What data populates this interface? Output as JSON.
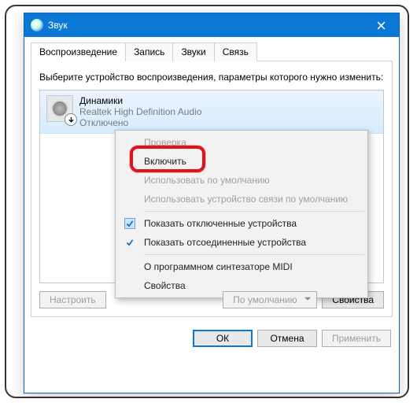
{
  "window": {
    "title": "Звук",
    "close_icon": "close-icon"
  },
  "tabs": [
    {
      "label": "Воспроизведение",
      "active": true
    },
    {
      "label": "Запись",
      "active": false
    },
    {
      "label": "Звуки",
      "active": false
    },
    {
      "label": "Связь",
      "active": false
    }
  ],
  "instruction": "Выберите устройство воспроизведения, параметры которого нужно изменить:",
  "device": {
    "name": "Динамики",
    "desc": "Realtek High Definition Audio",
    "status": "Отключено",
    "overlay": "down-arrow-icon"
  },
  "context_menu": {
    "items": [
      {
        "label": "Проверка",
        "disabled": true
      },
      {
        "label": "Включить",
        "disabled": false,
        "highlighted": true
      },
      {
        "label": "Использовать по умолчанию",
        "disabled": true
      },
      {
        "label": "Использовать устройство связи по умолчанию",
        "disabled": true
      },
      {
        "sep": true
      },
      {
        "label": "Показать отключенные устройства",
        "checked": true
      },
      {
        "label": "Показать отсоединенные устройства",
        "checked": true
      },
      {
        "sep": true
      },
      {
        "label": "О программном синтезаторе MIDI"
      },
      {
        "label": "Свойства"
      }
    ]
  },
  "panel_buttons": {
    "configure": "Настроить",
    "set_default": "По умолчанию",
    "properties": "Свойства"
  },
  "bottom_buttons": {
    "ok": "ОК",
    "cancel": "Отмена",
    "apply": "Применить"
  }
}
